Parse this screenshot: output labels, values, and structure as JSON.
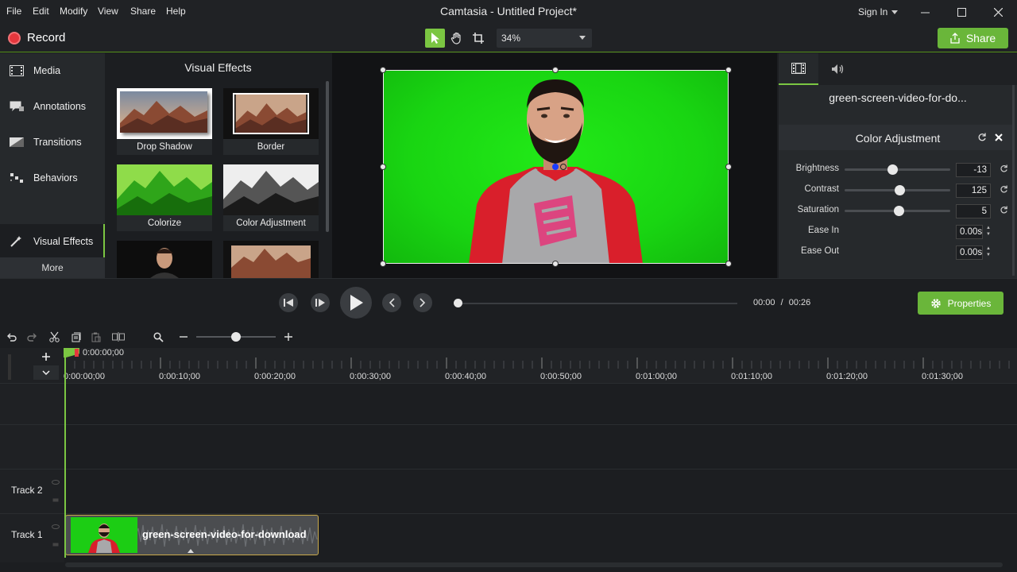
{
  "window": {
    "title": "Camtasia - Untitled Project*",
    "sign_in": "Sign In",
    "menu": [
      "File",
      "Edit",
      "Modify",
      "View",
      "Share",
      "Help"
    ]
  },
  "toolbar": {
    "record_label": "Record",
    "zoom_value": "34%",
    "share_label": "Share"
  },
  "sidebar": {
    "items": [
      {
        "label": "Media",
        "icon": "film-icon"
      },
      {
        "label": "Annotations",
        "icon": "annotation-icon"
      },
      {
        "label": "Transitions",
        "icon": "transition-icon"
      },
      {
        "label": "Behaviors",
        "icon": "behavior-icon"
      },
      {
        "label": "Visual Effects",
        "icon": "wand-icon"
      }
    ],
    "more_label": "More"
  },
  "library": {
    "title": "Visual Effects",
    "effects": [
      "Drop Shadow",
      "Border",
      "Colorize",
      "Color Adjustment"
    ]
  },
  "properties": {
    "clip_name": "green-screen-video-for-do...",
    "effect_title": "Color Adjustment",
    "brightness_label": "Brightness",
    "brightness_value": "-13",
    "brightness_level": 0.45,
    "contrast_label": "Contrast",
    "contrast_value": "125",
    "contrast_level": 0.52,
    "saturation_label": "Saturation",
    "saturation_value": "5",
    "saturation_level": 0.51,
    "ease_in_label": "Ease In",
    "ease_in_value": "0.00s",
    "ease_out_label": "Ease Out",
    "ease_out_value": "0.00s",
    "button_label": "Properties"
  },
  "playback": {
    "current_time": "00:00",
    "separator": "/",
    "total_time": "00:26",
    "progress": 0
  },
  "timeline": {
    "playhead_time": "0:00:00;00",
    "ruler": [
      "0:00:00;00",
      "0:00:10;00",
      "0:00:20;00",
      "0:00:30;00",
      "0:00:40;00",
      "0:00:50;00",
      "0:01:00;00",
      "0:01:10;00",
      "0:01:20;00",
      "0:01:30;00"
    ],
    "tracks": [
      "Track 2",
      "Track 1"
    ],
    "clip_label": "green-screen-video-for-download"
  },
  "colors": {
    "accent": "#7bc642",
    "button_green": "#6ab63a",
    "record_red": "#e5373d",
    "green_screen": "#1ccd14",
    "clip_border": "#c9a94b"
  }
}
